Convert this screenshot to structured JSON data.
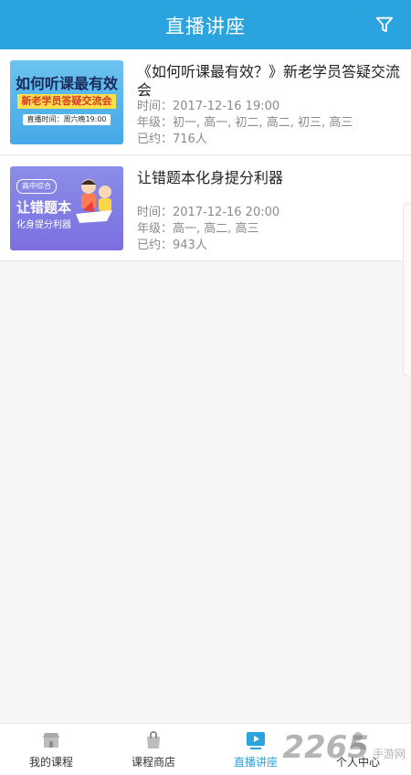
{
  "header": {
    "title": "直播讲座",
    "filter_icon": "filter-icon"
  },
  "lectures": [
    {
      "title": "《如何听课最有效？》新老学员答疑交流会",
      "time": "时间：2017-12-16 19:00",
      "grades": "年级：初一, 高一, 初二, 高二, 初三, 高三",
      "signed_up": "已约：716人",
      "thumb": {
        "line1": "如何听课最有效",
        "line2": "新老学员答疑交流会",
        "line3": "直播时间：周六晚19:00"
      }
    },
    {
      "title": "让错题本化身提分利器",
      "time": "时间：2017-12-16 20:00",
      "grades": "年级：高一, 高二, 高三",
      "signed_up": "已约：943人",
      "thumb": {
        "badge": "高中综合",
        "line1": "让错题本",
        "line2": "化身提分利器"
      }
    }
  ],
  "tabbar": {
    "tabs": [
      {
        "label": "我的课程",
        "icon": "store-icon"
      },
      {
        "label": "课程商店",
        "icon": "bag-icon"
      },
      {
        "label": "直播讲座",
        "icon": "play-screen-icon",
        "active": true
      },
      {
        "label": "个人中心",
        "icon": "person-icon"
      }
    ]
  },
  "watermark": {
    "text": "2265",
    "sub": "手游网"
  },
  "colors": {
    "accent": "#2aa3df",
    "header_bg": "#2aa3df",
    "background": "#f6f6f6"
  }
}
